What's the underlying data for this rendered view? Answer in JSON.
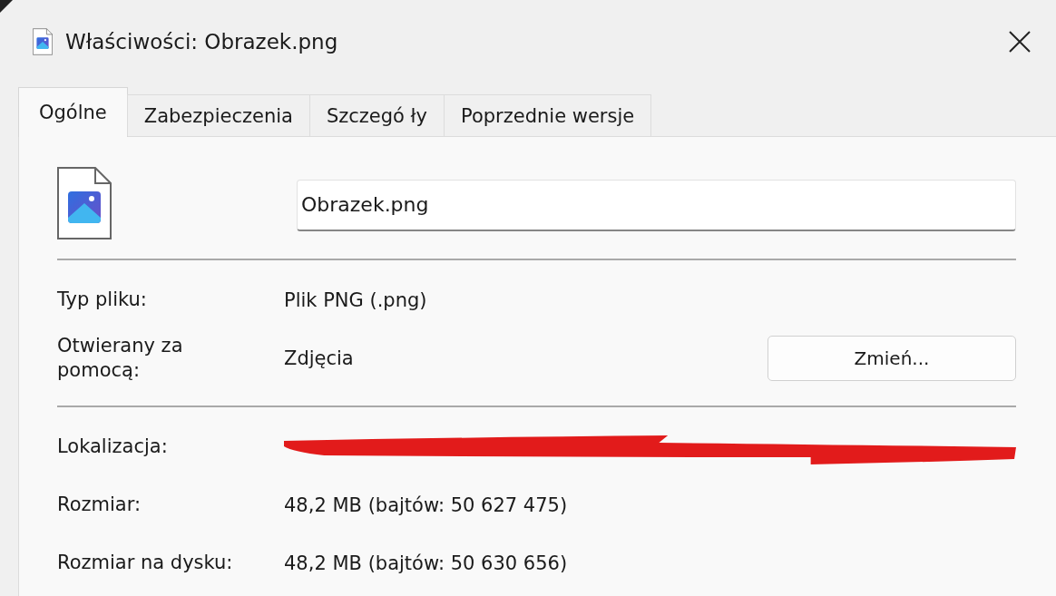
{
  "window": {
    "title": "Właściwości: Obrazek.png"
  },
  "tabs": [
    {
      "label": "Ogólne",
      "selected": true
    },
    {
      "label": "Zabezpieczenia",
      "selected": false
    },
    {
      "label": "Szczegó ły",
      "selected": false
    },
    {
      "label": "Poprzednie wersje",
      "selected": false
    }
  ],
  "file": {
    "name": "Obrazek.png"
  },
  "sections": [
    [
      {
        "kind": "text",
        "label": "Typ pliku:",
        "value": "Plik PNG (.png)"
      },
      {
        "kind": "button",
        "label": "Otwierany za pomocą:",
        "value": "Zdjęcia",
        "button": "Zmień..."
      }
    ],
    [
      {
        "kind": "redacted",
        "label": "Lokalizacja:"
      },
      {
        "kind": "text",
        "label": "Rozmiar:",
        "value": "48,2 MB (bajtów: 50 627 475)"
      },
      {
        "kind": "text",
        "label": "Rozmiar na dysku:",
        "value": "48,2 MB (bajtów: 50 630 656)"
      }
    ]
  ]
}
